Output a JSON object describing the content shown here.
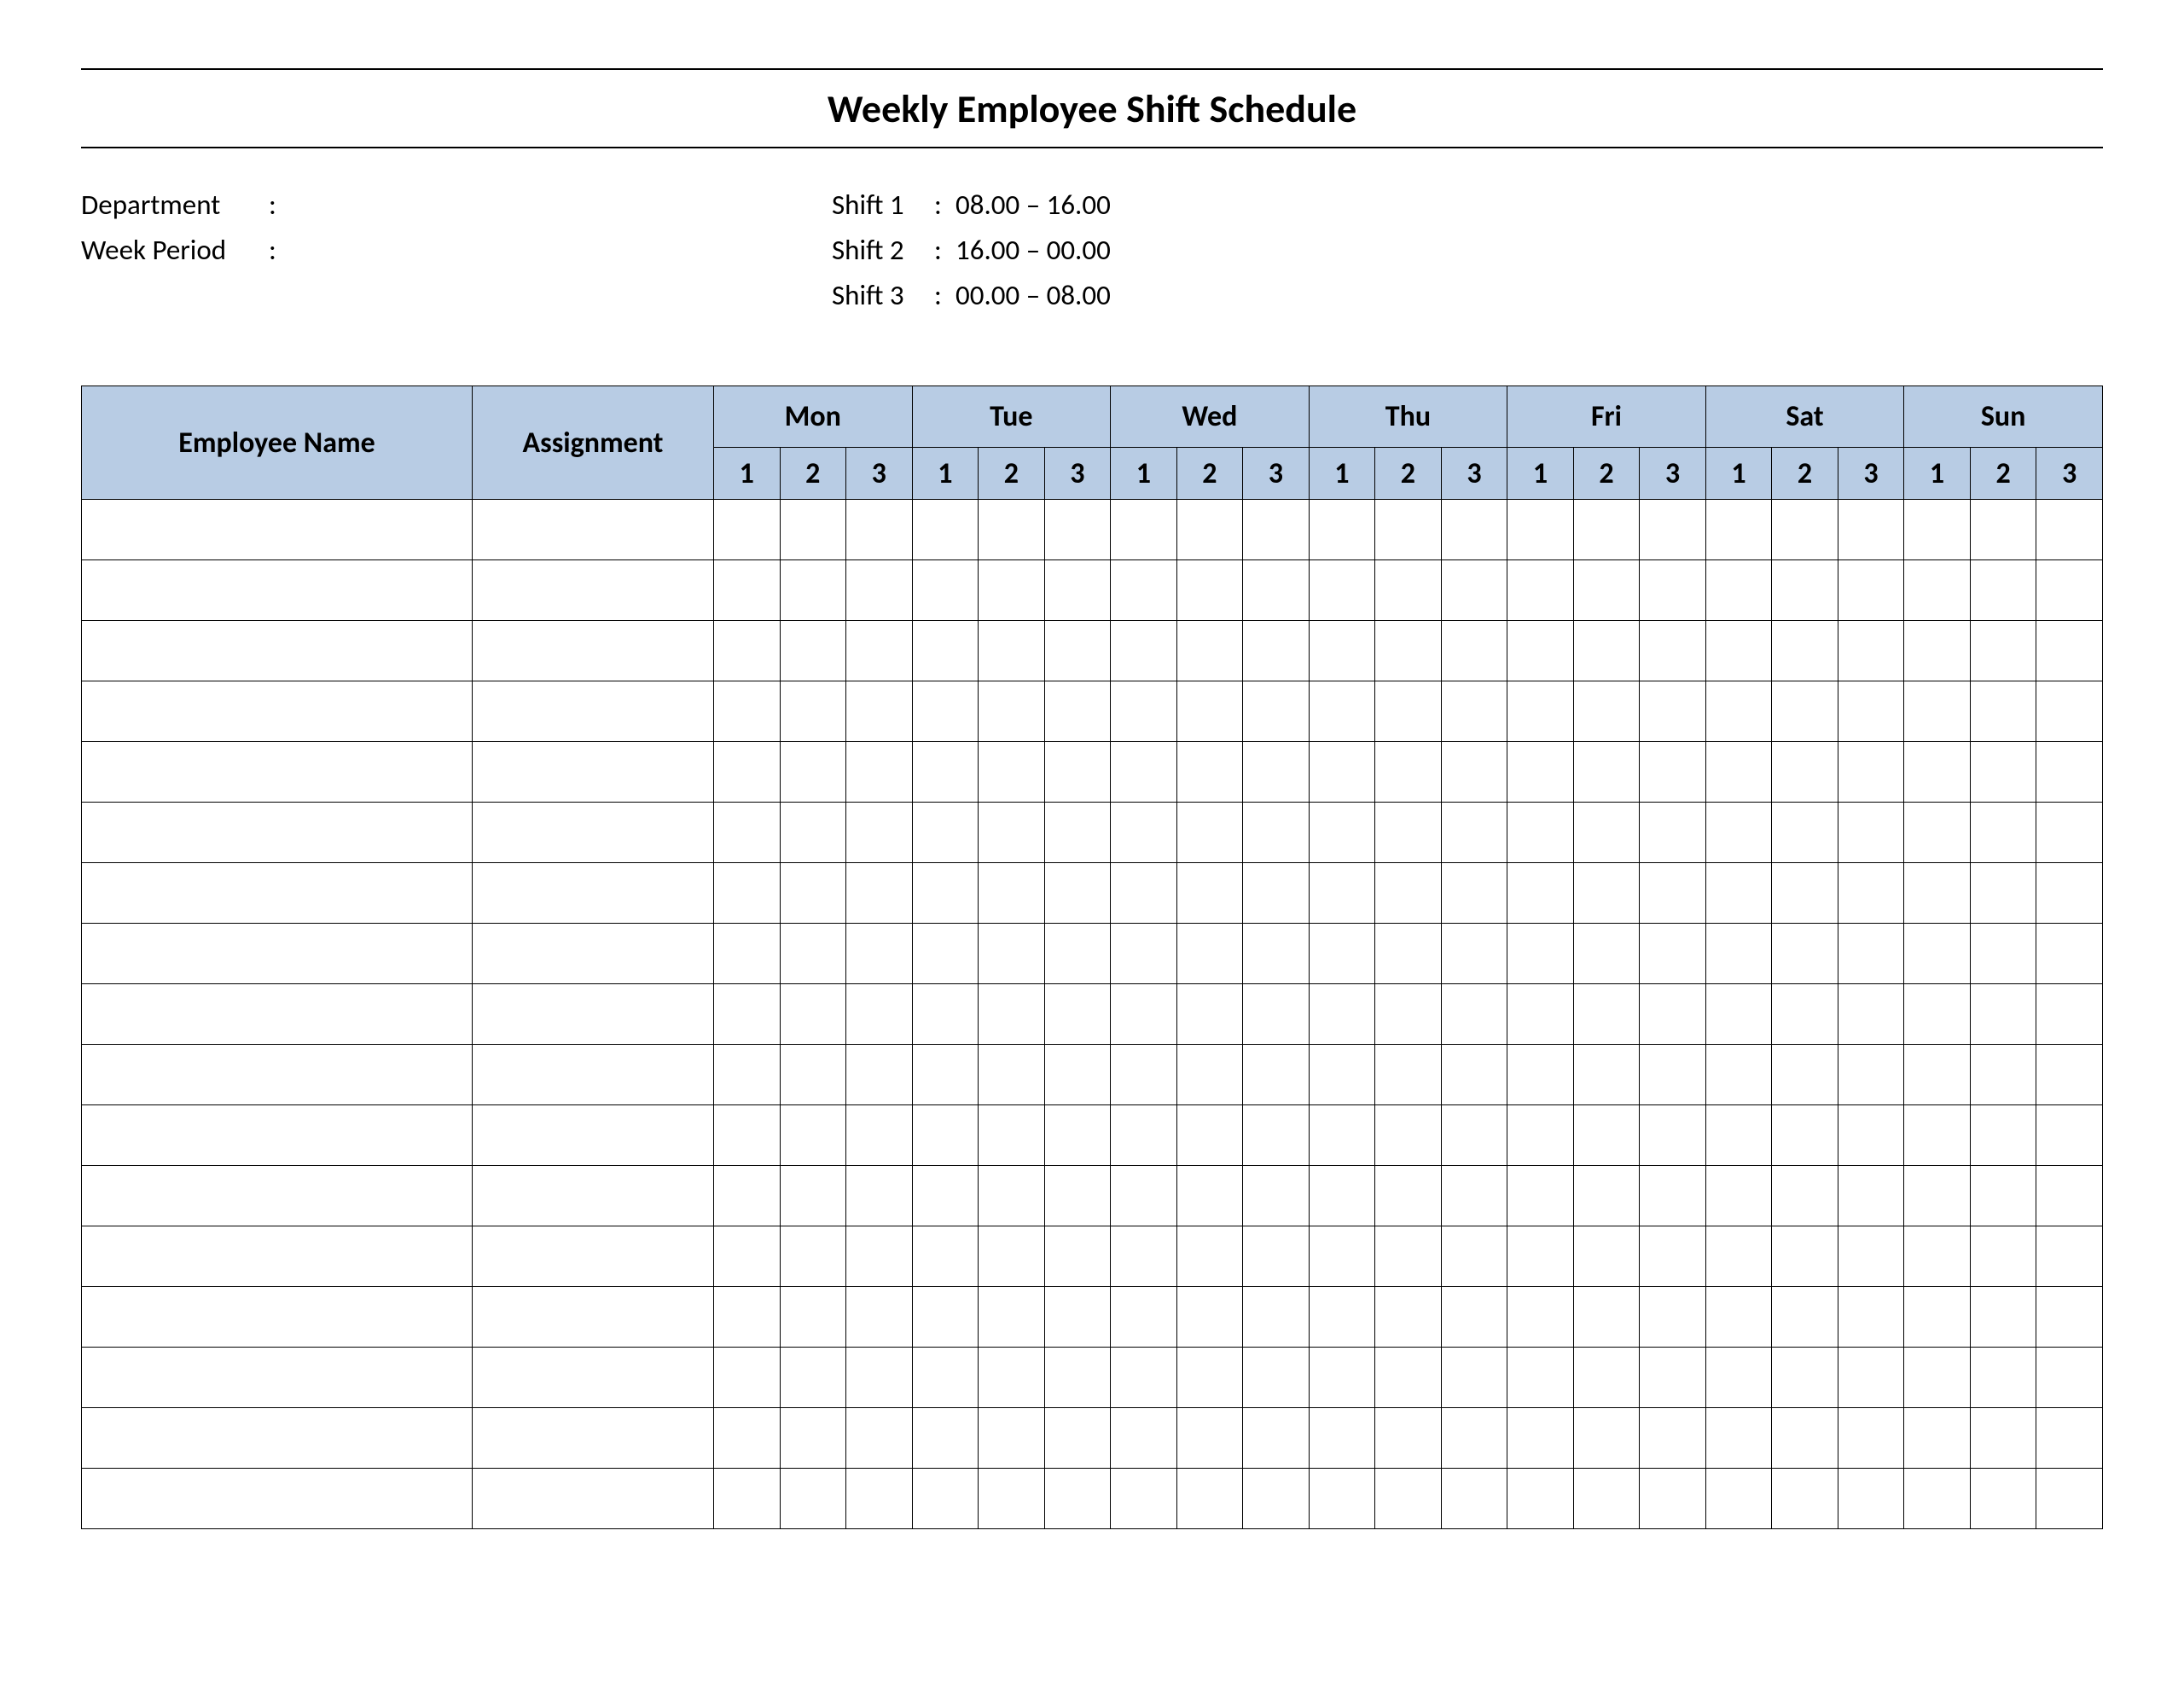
{
  "title": "Weekly Employee Shift Schedule",
  "meta": {
    "department_label": "Department",
    "department_value": "",
    "week_period_label": "Week  Period",
    "week_period_value": ""
  },
  "shifts": [
    {
      "label": "Shift 1",
      "time": "08.00  – 16.00"
    },
    {
      "label": "Shift 2",
      "time": "16.00  – 00.00"
    },
    {
      "label": "Shift 3",
      "time": "00.00  – 08.00"
    }
  ],
  "headers": {
    "employee_name": "Employee Name",
    "assignment": "Assignment",
    "days": [
      "Mon",
      "Tue",
      "Wed",
      "Thu",
      "Fri",
      "Sat",
      "Sun"
    ],
    "shift_nums": [
      "1",
      "2",
      "3"
    ]
  },
  "row_count": 17
}
